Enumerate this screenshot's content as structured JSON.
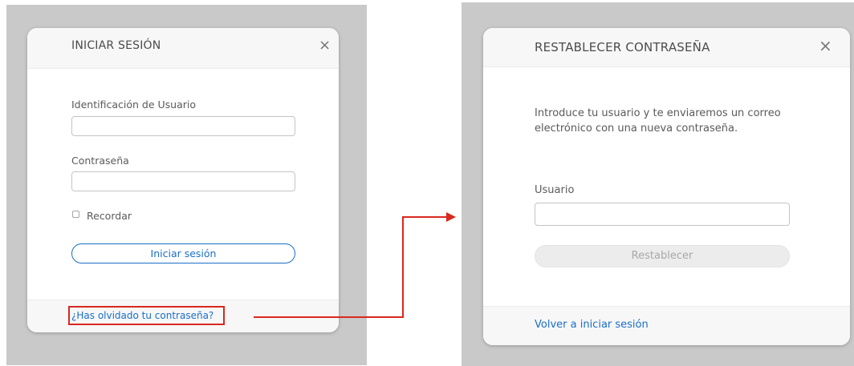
{
  "login": {
    "title": "INICIAR SESIÓN",
    "close_glyph": "×",
    "user_label": "Identificación de Usuario",
    "user_value": "",
    "password_label": "Contraseña",
    "password_value": "",
    "remember_label": "Recordar",
    "remember_checked": false,
    "submit_label": "Iniciar sesión",
    "forgot_link": "¿Has olvidado tu contraseña?"
  },
  "reset": {
    "title": "RESTABLECER CONTRASEÑA",
    "close_glyph": "×",
    "intro": "Introduce tu usuario y te enviaremos un correo electrónico con una nueva contraseña.",
    "user_label": "Usuario",
    "user_value": "",
    "submit_label": "Restablecer",
    "back_link": "Volver a iniciar sesión"
  },
  "colors": {
    "highlight": "#d9281e",
    "link": "#1a6fc7",
    "panel_bg": "#c9c9c9",
    "primary_button_border": "#1a6fc7",
    "disabled_button_bg": "#ececec"
  },
  "icons": {
    "close": "close-icon",
    "checkbox": "checkbox-icon",
    "arrow": "arrow-right-icon"
  }
}
